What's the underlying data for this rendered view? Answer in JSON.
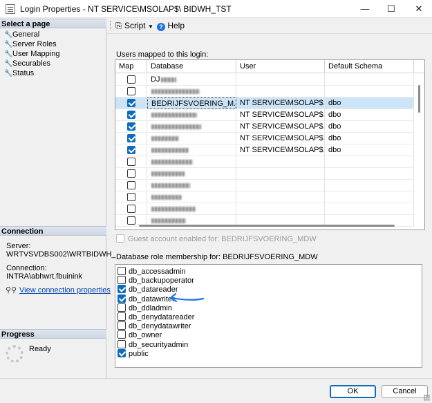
{
  "window": {
    "title": "Login Properties - NT SERVICE\\MSOLAP$\\     BIDWH_TST",
    "minimize": "—",
    "maximize": "☐",
    "close": "✕"
  },
  "sidebar": {
    "select_page_header": "Select a page",
    "pages": [
      "General",
      "Server Roles",
      "User Mapping",
      "Securables",
      "Status"
    ],
    "connection_header": "Connection",
    "server_label": "Server:",
    "server_value": "WRTVSVDBS002\\WRTBIDWH_",
    "connection_label": "Connection:",
    "connection_value": "INTRA\\abhwrt.fbuinink",
    "view_connection_link": "View connection properties",
    "progress_header": "Progress",
    "progress_status": "Ready"
  },
  "toolbar": {
    "script_label": "Script",
    "help_label": "Help"
  },
  "users_mapped": {
    "label": "Users mapped to this login:",
    "columns": [
      "Map",
      "Database",
      "User",
      "Default Schema"
    ],
    "rows": [
      {
        "map": false,
        "database": "DJ",
        "user": "",
        "schema": "",
        "selected": false,
        "blurred": false
      },
      {
        "map": false,
        "database": "",
        "user": "",
        "schema": "",
        "selected": false,
        "blurred": true
      },
      {
        "map": true,
        "database": "BEDRIJFSVOERING_M...",
        "user": "NT SERVICE\\MSOLAP$...",
        "schema": "dbo",
        "selected": true,
        "blurred": false
      },
      {
        "map": true,
        "database": "",
        "user": "NT SERVICE\\MSOLAP$...",
        "schema": "dbo",
        "selected": false,
        "blurred": true
      },
      {
        "map": true,
        "database": "",
        "user": "NT SERVICE\\MSOLAP$...",
        "schema": "dbo",
        "selected": false,
        "blurred": true
      },
      {
        "map": true,
        "database": "",
        "user": "NT SERVICE\\MSOLAP$...",
        "schema": "dbo",
        "selected": false,
        "blurred": true
      },
      {
        "map": true,
        "database": "",
        "user": "NT SERVICE\\MSOLAP$...",
        "schema": "dbo",
        "selected": false,
        "blurred": true
      },
      {
        "map": false,
        "database": "",
        "user": "",
        "schema": "",
        "selected": false,
        "blurred": true
      },
      {
        "map": false,
        "database": "",
        "user": "",
        "schema": "",
        "selected": false,
        "blurred": true
      },
      {
        "map": false,
        "database": "",
        "user": "",
        "schema": "",
        "selected": false,
        "blurred": true
      },
      {
        "map": false,
        "database": "",
        "user": "",
        "schema": "",
        "selected": false,
        "blurred": true
      },
      {
        "map": false,
        "database": "",
        "user": "",
        "schema": "",
        "selected": false,
        "blurred": true
      },
      {
        "map": false,
        "database": "",
        "user": "",
        "schema": "",
        "selected": false,
        "blurred": true
      }
    ]
  },
  "guest": {
    "label": "Guest account enabled for: BEDRIJFSVOERING_MDW",
    "checked": false
  },
  "role_membership": {
    "label": "Database role membership for: BEDRIJFSVOERING_MDW",
    "roles": [
      {
        "name": "db_accessadmin",
        "checked": false
      },
      {
        "name": "db_backupoperator",
        "checked": false
      },
      {
        "name": "db_datareader",
        "checked": true
      },
      {
        "name": "db_datawriter",
        "checked": true
      },
      {
        "name": "db_ddladmin",
        "checked": false
      },
      {
        "name": "db_denydatareader",
        "checked": false
      },
      {
        "name": "db_denydatawriter",
        "checked": false
      },
      {
        "name": "db_owner",
        "checked": false
      },
      {
        "name": "db_securityadmin",
        "checked": false
      },
      {
        "name": "public",
        "checked": true
      }
    ]
  },
  "footer": {
    "ok_label": "OK",
    "cancel_label": "Cancel"
  },
  "colors": {
    "accent": "#0f6cbd",
    "selection": "#cce4f7",
    "annotation_arrow": "#1a73e8"
  }
}
